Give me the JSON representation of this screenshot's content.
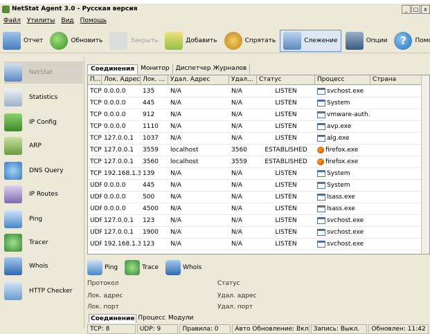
{
  "window": {
    "title": "NetStat Agent 3.0 - Русская версия",
    "controls": [
      "_",
      "□",
      "x"
    ]
  },
  "menu": [
    "Файл",
    "Утилиты",
    "Вид",
    "Помощь"
  ],
  "toolbar": {
    "report": "Отчет",
    "refresh": "Обновить",
    "close": "Закрыть",
    "add": "Добавить",
    "hide": "Спрятать",
    "watch": "Слежение",
    "options": "Опции",
    "help": "Помощь"
  },
  "sidebar": {
    "items": [
      {
        "label": "NetStat",
        "icon": "netstat-icon"
      },
      {
        "label": "Statistics",
        "icon": "statistics-icon"
      },
      {
        "label": "IP Config",
        "icon": "ip-config-icon"
      },
      {
        "label": "ARP",
        "icon": "arp-icon"
      },
      {
        "label": "DNS Query",
        "icon": "dns-query-icon"
      },
      {
        "label": "IP Routes",
        "icon": "ip-routes-icon"
      },
      {
        "label": "Ping",
        "icon": "ping-icon"
      },
      {
        "label": "Tracer",
        "icon": "tracer-icon"
      },
      {
        "label": "Whois",
        "icon": "whois-icon"
      },
      {
        "label": "HTTP Checker",
        "icon": "http-checker-icon"
      }
    ]
  },
  "tabs": [
    "Соединения",
    "Монитор",
    "Диспетчер Журналов"
  ],
  "table": {
    "columns": [
      "П...",
      "Лок. Адрес",
      "Лок. ...",
      "Удал. Адрес",
      "Удал...",
      "Статус",
      "Процесс",
      "Страна"
    ],
    "rows": [
      [
        "TCP",
        "0.0.0.0",
        "135",
        "N/A",
        "N/A",
        "LISTEN",
        "svchost.exe"
      ],
      [
        "TCP",
        "0.0.0.0",
        "445",
        "N/A",
        "N/A",
        "LISTEN",
        "System"
      ],
      [
        "TCP",
        "0.0.0.0",
        "912",
        "N/A",
        "N/A",
        "LISTEN",
        "vmware-auth..."
      ],
      [
        "TCP",
        "0.0.0.0",
        "1110",
        "N/A",
        "N/A",
        "LISTEN",
        "avp.exe"
      ],
      [
        "TCP",
        "127.0.0.1",
        "1037",
        "N/A",
        "N/A",
        "LISTEN",
        "alg.exe"
      ],
      [
        "TCP",
        "127.0.0.1",
        "3559",
        "localhost",
        "3560",
        "ESTABLISHED",
        "firefox.exe"
      ],
      [
        "TCP",
        "127.0.0.1",
        "3560",
        "localhost",
        "3559",
        "ESTABLISHED",
        "firefox.exe"
      ],
      [
        "TCP",
        "192.168.1.3",
        "139",
        "N/A",
        "N/A",
        "LISTEN",
        "System"
      ],
      [
        "UDP",
        "0.0.0.0",
        "445",
        "N/A",
        "N/A",
        "LISTEN",
        "System"
      ],
      [
        "UDP",
        "0.0.0.0",
        "500",
        "N/A",
        "N/A",
        "LISTEN",
        "lsass.exe"
      ],
      [
        "UDP",
        "0.0.0.0",
        "4500",
        "N/A",
        "N/A",
        "LISTEN",
        "lsass.exe"
      ],
      [
        "UDP",
        "127.0.0.1",
        "123",
        "N/A",
        "N/A",
        "LISTEN",
        "svchost.exe"
      ],
      [
        "UDP",
        "127.0.0.1",
        "1900",
        "N/A",
        "N/A",
        "LISTEN",
        "svchost.exe"
      ],
      [
        "UDP",
        "192.168.1.3",
        "123",
        "N/A",
        "N/A",
        "LISTEN",
        "svchost.exe"
      ]
    ]
  },
  "lower_toolbar": {
    "ping": "Ping",
    "trace": "Trace",
    "whois": "Whois"
  },
  "details": {
    "protocol": "Протокол",
    "local_address": "Лок. адрес",
    "local_port": "Лок. порт",
    "status": "Статус",
    "remote_address": "Удал. адрес",
    "remote_port": "Удал. порт"
  },
  "bottom_tabs": [
    "Соединение",
    "Процесс",
    "Модули"
  ],
  "statusbar": {
    "tcp": "TCP: 8",
    "udp": "UDP: 9",
    "rules": "Правила: 0",
    "autoupdate": "Авто Обновление: Вкл.",
    "record": "Запись: Выкл.",
    "updated": "Обновлен: 11:42"
  }
}
